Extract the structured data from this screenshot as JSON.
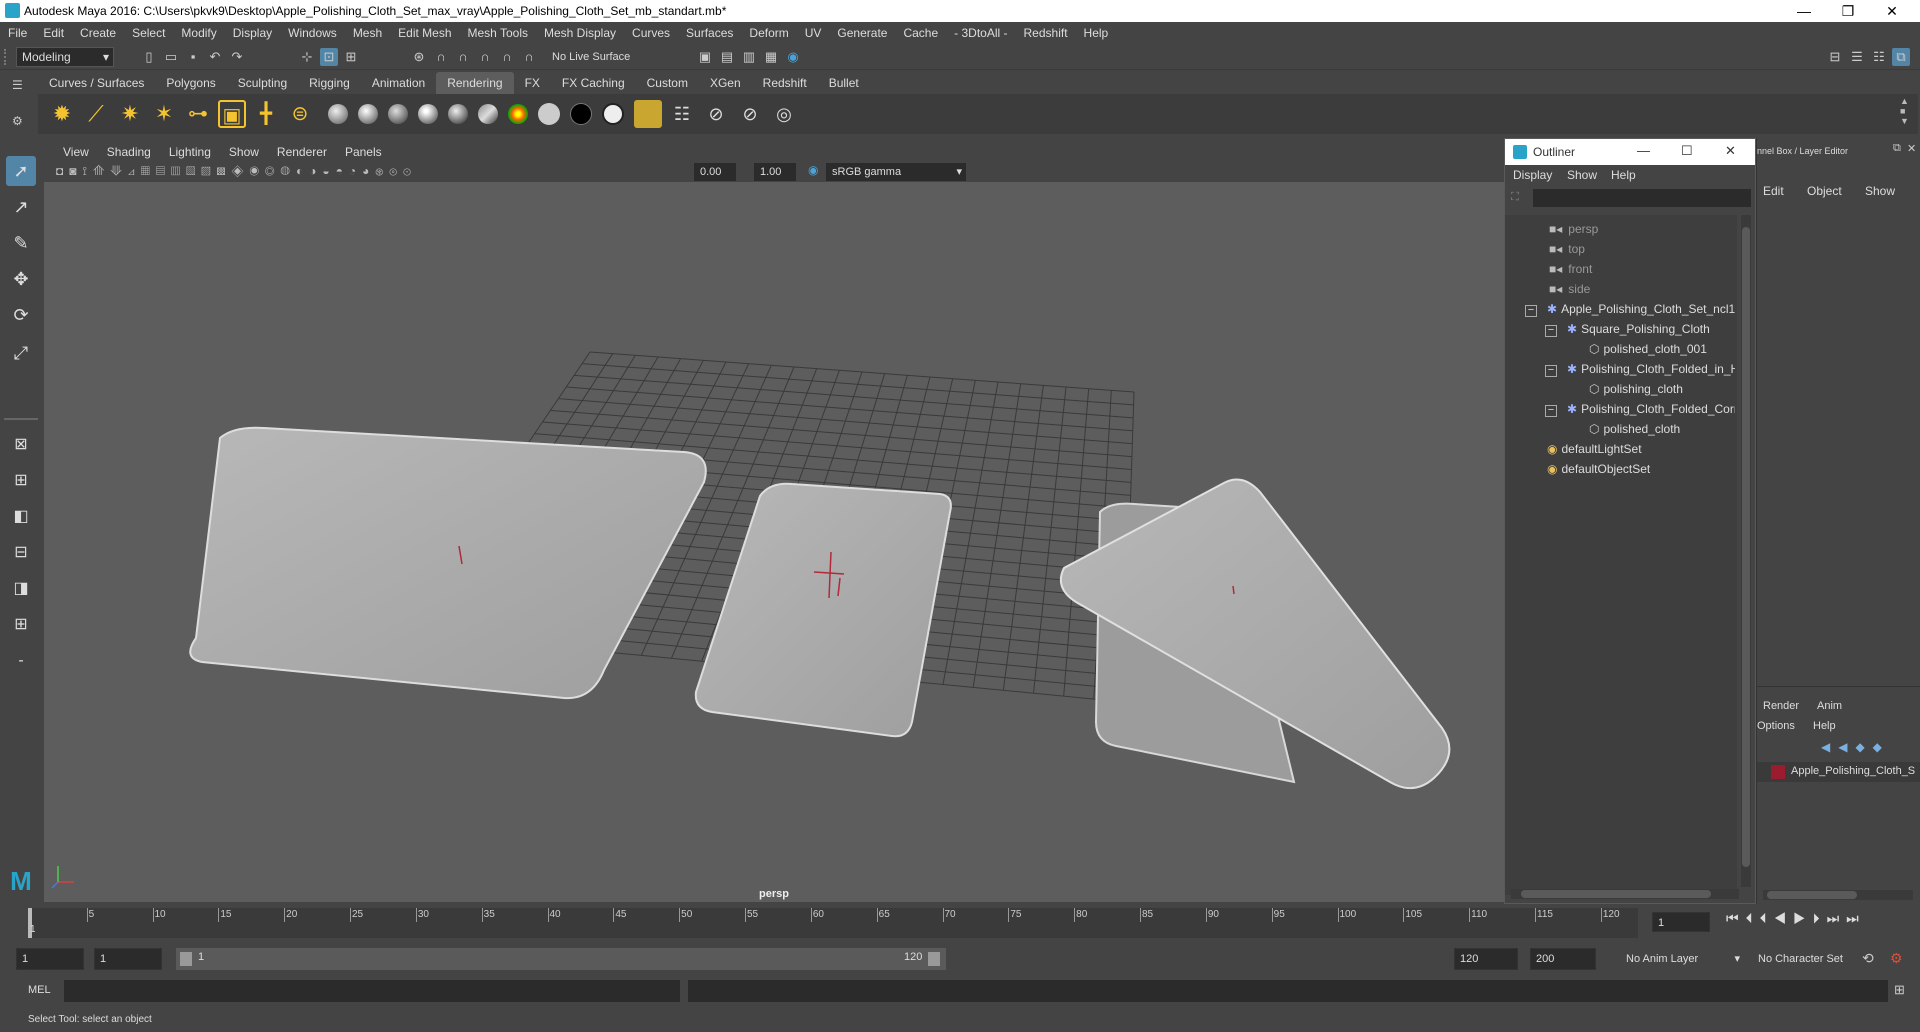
{
  "window": {
    "title": "Autodesk Maya 2016: C:\\Users\\pkvk9\\Desktop\\Apple_Polishing_Cloth_Set_max_vray\\Apple_Polishing_Cloth_Set_mb_standart.mb*"
  },
  "menubar": [
    "File",
    "Edit",
    "Create",
    "Select",
    "Modify",
    "Display",
    "Windows",
    "Mesh",
    "Edit Mesh",
    "Mesh Tools",
    "Mesh Display",
    "Curves",
    "Surfaces",
    "Deform",
    "UV",
    "Generate",
    "Cache",
    "- 3DtoAll -",
    "Redshift",
    "Help"
  ],
  "status": {
    "mode": "Modeling",
    "live_surface": "No Live Surface"
  },
  "shelf_tabs": [
    "Curves / Surfaces",
    "Polygons",
    "Sculpting",
    "Rigging",
    "Animation",
    "Rendering",
    "FX",
    "FX Caching",
    "Custom",
    "XGen",
    "Redshift",
    "Bullet"
  ],
  "viewport": {
    "menus": [
      "View",
      "Shading",
      "Lighting",
      "Show",
      "Renderer",
      "Panels"
    ],
    "exposure": "0.00",
    "gamma": "1.00",
    "color_space": "sRGB gamma",
    "camera_label": "persp"
  },
  "outliner": {
    "title": "Outliner",
    "menus": [
      "Display",
      "Show",
      "Help"
    ],
    "items": [
      {
        "label": "persp",
        "type": "camera"
      },
      {
        "label": "top",
        "type": "camera"
      },
      {
        "label": "front",
        "type": "camera"
      },
      {
        "label": "side",
        "type": "camera"
      },
      {
        "label": "Apple_Polishing_Cloth_Set_ncl1_",
        "type": "group"
      },
      {
        "label": "Square_Polishing_Cloth",
        "type": "group"
      },
      {
        "label": "polished_cloth_001",
        "type": "mesh"
      },
      {
        "label": "Polishing_Cloth_Folded_in_H",
        "type": "group"
      },
      {
        "label": "polishing_cloth",
        "type": "mesh"
      },
      {
        "label": "Polishing_Cloth_Folded_Corr",
        "type": "group"
      },
      {
        "label": "polished_cloth",
        "type": "mesh"
      },
      {
        "label": "defaultLightSet",
        "type": "set"
      },
      {
        "label": "defaultObjectSet",
        "type": "set"
      }
    ]
  },
  "channel_box": {
    "title": "nnel Box / Layer Editor",
    "menus": [
      "Edit",
      "Object",
      "Show"
    ],
    "layer_tabs": [
      "Render",
      "Anim"
    ],
    "layer_menus": [
      "Options",
      "Help"
    ],
    "layer_name": "Apple_Polishing_Cloth_S",
    "layer_color": "#9b1c2e"
  },
  "timeline": {
    "ticks": [
      "5",
      "10",
      "15",
      "20",
      "25",
      "30",
      "35",
      "40",
      "45",
      "50",
      "55",
      "60",
      "65",
      "70",
      "75",
      "80",
      "85",
      "90",
      "95",
      "100",
      "105",
      "110",
      "115",
      "120"
    ],
    "start_marker": "1",
    "current_frame": "1"
  },
  "range": {
    "start": "1",
    "anim_start": "1",
    "slider_start": "1",
    "slider_end": "120",
    "end": "120",
    "anim_end": "200",
    "anim_layer": "No Anim Layer",
    "character_set": "No Character Set"
  },
  "command_line": {
    "label": "MEL"
  },
  "help_line": {
    "text": "Select Tool: select an object"
  }
}
